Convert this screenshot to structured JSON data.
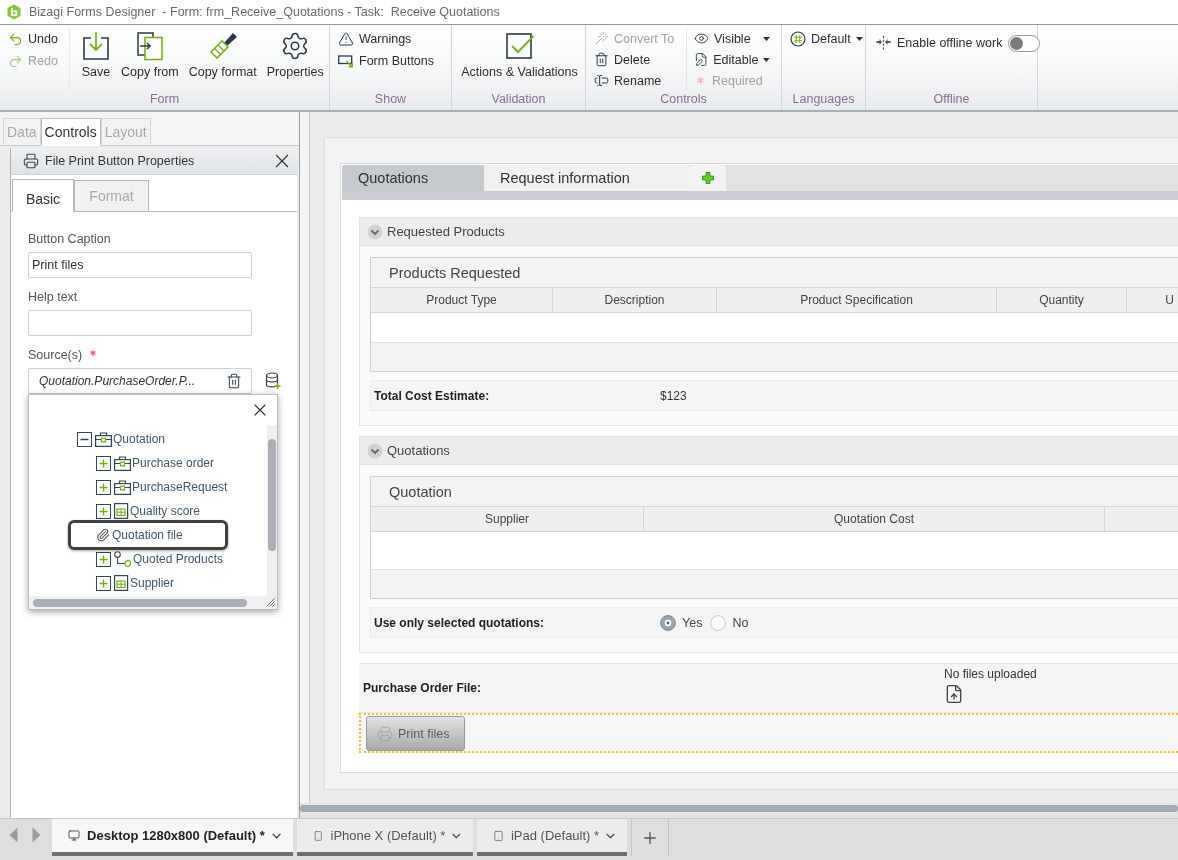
{
  "window": {
    "title": "Bizagi Forms Designer  - Form: frm_Receive_Quotations - Task:  Receive Quotations"
  },
  "ribbon": {
    "form": {
      "label": "Form",
      "undo": {
        "label": "Undo",
        "disabled": false
      },
      "redo": {
        "label": "Redo",
        "disabled": true
      },
      "save": "Save",
      "copy_from": "Copy from",
      "copy_format": "Copy format",
      "properties": "Properties"
    },
    "show": {
      "label": "Show",
      "warnings": "Warnings",
      "form_buttons": "Form Buttons"
    },
    "validation": {
      "label": "Validation",
      "actions": "Actions & Validations"
    },
    "controls": {
      "label": "Controls",
      "convert_to": {
        "label": "Convert To",
        "disabled": true
      },
      "delete": {
        "label": "Delete",
        "disabled": false
      },
      "rename": {
        "label": "Rename",
        "disabled": false
      },
      "visible": {
        "label": "Visible",
        "disabled": false
      },
      "editable": {
        "label": "Editable",
        "disabled": false
      },
      "required": {
        "label": "Required",
        "disabled": true
      }
    },
    "languages": {
      "label": "Languages",
      "language": "Default"
    },
    "offline": {
      "label": "Offline",
      "toggle_label": "Enable offline work",
      "on": false
    }
  },
  "left_panel": {
    "tabs": [
      {
        "label": "Data",
        "selected": false
      },
      {
        "label": "Controls",
        "selected": true
      },
      {
        "label": "Layout",
        "selected": false
      }
    ],
    "properties": {
      "title": "File Print Button Properties",
      "tabs": [
        {
          "label": "Basic",
          "selected": true
        },
        {
          "label": "Format",
          "selected": false
        }
      ],
      "fields": [
        {
          "kind": "text",
          "label": "Button Caption",
          "value": "Print files",
          "required": false
        },
        {
          "kind": "text",
          "label": "Help text",
          "required": false
        },
        {
          "kind": "source",
          "label": "Source(s)",
          "value": "Quotation.PurchaseOrder.P...",
          "required": true
        }
      ],
      "source_tree": [
        {
          "kind": "entity",
          "label": "Quotation",
          "expanded": true,
          "highlighted": false,
          "children": [
            {
              "kind": "entity",
              "label": "Purchase order",
              "expanded": false,
              "highlighted": false
            },
            {
              "kind": "entity",
              "label": "PurchaseRequest",
              "expanded": false,
              "highlighted": false
            },
            {
              "kind": "table",
              "label": "Quality score",
              "expanded": false,
              "highlighted": false
            },
            {
              "kind": "file",
              "label": "Quotation file",
              "highlighted": true
            },
            {
              "kind": "collection",
              "label": "Quoted Products",
              "expanded": false,
              "highlighted": false
            },
            {
              "kind": "table",
              "label": "Supplier",
              "expanded": false,
              "highlighted": false
            }
          ]
        }
      ]
    }
  },
  "form": {
    "tabs": [
      {
        "label": "Quotations",
        "selected": true
      },
      {
        "label": "Request information",
        "selected": false
      }
    ],
    "groups": [
      {
        "title": "Requested Products",
        "expanded": true,
        "grid": {
          "title": "Products Requested",
          "columns": [
            "Product Type",
            "Description",
            "Product Specification",
            "Quantity",
            "U"
          ]
        },
        "fields": [
          {
            "kind": "value",
            "label": "Total Cost Estimate:",
            "value": "$123"
          }
        ]
      },
      {
        "title": "Quotations",
        "expanded": true,
        "grid": {
          "title": "Quotation",
          "columns": [
            "Supplier",
            "Quotation Cost"
          ]
        },
        "fields": [
          {
            "kind": "radio",
            "label": "Use only selected quotations:",
            "options": [
              {
                "label": "Yes",
                "selected": true
              },
              {
                "label": "No",
                "selected": false
              }
            ]
          }
        ]
      }
    ],
    "upload": {
      "label": "Purchase Order File:",
      "status": "No files uploaded"
    },
    "print_button": {
      "label": "Print files",
      "selected": true
    }
  },
  "device_tabs": [
    {
      "kind": "desktop",
      "label": "Desktop 1280x800 (Default) *",
      "selected": true
    },
    {
      "kind": "phone",
      "label": "iPhone X (Default) *",
      "selected": false
    },
    {
      "kind": "tablet",
      "label": "iPad (Default) *",
      "selected": false
    }
  ]
}
